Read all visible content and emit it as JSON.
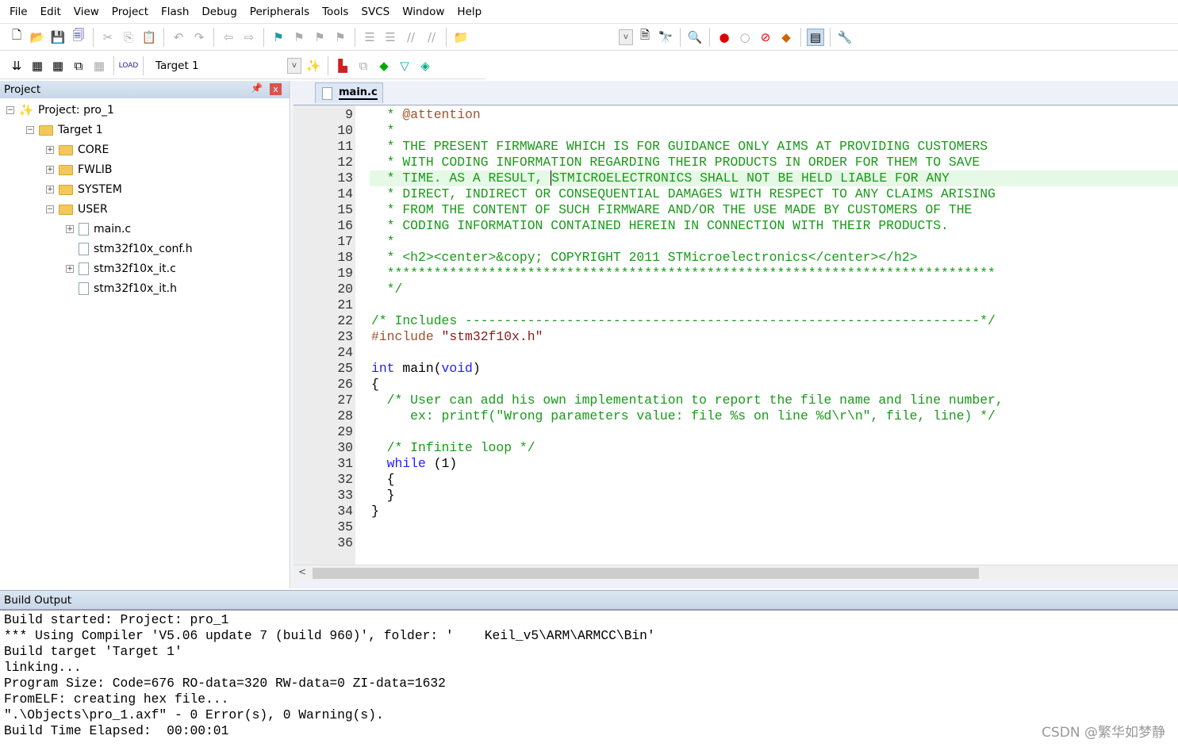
{
  "menu": [
    "File",
    "Edit",
    "View",
    "Project",
    "Flash",
    "Debug",
    "Peripherals",
    "Tools",
    "SVCS",
    "Window",
    "Help"
  ],
  "toolbar2": {
    "target": "Target 1"
  },
  "project": {
    "title": "Project",
    "pin": "📌",
    "close": "x",
    "items": [
      {
        "label": "Project: pro_1",
        "level": 0,
        "exp": "−",
        "kind": "project"
      },
      {
        "label": "Target 1",
        "level": 1,
        "exp": "−",
        "kind": "target"
      },
      {
        "label": "CORE",
        "level": 2,
        "exp": "+",
        "kind": "folder"
      },
      {
        "label": "FWLIB",
        "level": 2,
        "exp": "+",
        "kind": "folder"
      },
      {
        "label": "SYSTEM",
        "level": 2,
        "exp": "+",
        "kind": "folder"
      },
      {
        "label": "USER",
        "level": 2,
        "exp": "−",
        "kind": "folder"
      },
      {
        "label": "main.c",
        "level": 3,
        "exp": "+",
        "kind": "file"
      },
      {
        "label": "stm32f10x_conf.h",
        "level": 3,
        "exp": "",
        "kind": "file"
      },
      {
        "label": "stm32f10x_it.c",
        "level": 3,
        "exp": "+",
        "kind": "file"
      },
      {
        "label": "stm32f10x_it.h",
        "level": 3,
        "exp": "",
        "kind": "file"
      }
    ]
  },
  "editor": {
    "tab": "main.c",
    "lines": [
      {
        "n": "9",
        "t": [
          [
            "cm",
            "  * "
          ],
          [
            "doc",
            "@attention"
          ]
        ]
      },
      {
        "n": "10",
        "t": [
          [
            "cm",
            "  *"
          ]
        ]
      },
      {
        "n": "11",
        "t": [
          [
            "cm",
            "  * THE PRESENT FIRMWARE WHICH IS FOR GUIDANCE ONLY AIMS AT PROVIDING CUSTOMERS"
          ]
        ]
      },
      {
        "n": "12",
        "t": [
          [
            "cm",
            "  * WITH CODING INFORMATION REGARDING THEIR PRODUCTS IN ORDER FOR THEM TO SAVE"
          ]
        ]
      },
      {
        "n": "13",
        "hl": true,
        "t": [
          [
            "cm",
            "  * TIME. AS A RESULT, "
          ],
          [
            "caret",
            "STMICROELECTRONICS SHALL NOT BE HELD LIABLE FOR ANY"
          ]
        ]
      },
      {
        "n": "14",
        "t": [
          [
            "cm",
            "  * DIRECT, INDIRECT OR CONSEQUENTIAL DAMAGES WITH RESPECT TO ANY CLAIMS ARISING"
          ]
        ]
      },
      {
        "n": "15",
        "t": [
          [
            "cm",
            "  * FROM THE CONTENT OF SUCH FIRMWARE AND/OR THE USE MADE BY CUSTOMERS OF THE"
          ]
        ]
      },
      {
        "n": "16",
        "t": [
          [
            "cm",
            "  * CODING INFORMATION CONTAINED HEREIN IN CONNECTION WITH THEIR PRODUCTS."
          ]
        ]
      },
      {
        "n": "17",
        "t": [
          [
            "cm",
            "  *"
          ]
        ]
      },
      {
        "n": "18",
        "t": [
          [
            "cm",
            "  * <h2><center>&copy; COPYRIGHT 2011 STMicroelectronics</center></h2>"
          ]
        ]
      },
      {
        "n": "19",
        "t": [
          [
            "cm",
            "  ******************************************************************************"
          ]
        ]
      },
      {
        "n": "20",
        "t": [
          [
            "cm",
            "  */"
          ]
        ]
      },
      {
        "n": "21",
        "t": []
      },
      {
        "n": "22",
        "t": [
          [
            "cm",
            "/* Includes ------------------------------------------------------------------*/"
          ]
        ]
      },
      {
        "n": "23",
        "t": [
          [
            "pp",
            "#include "
          ],
          [
            "str",
            "\"stm32f10x.h\""
          ]
        ]
      },
      {
        "n": "24",
        "t": []
      },
      {
        "n": "25",
        "t": [
          [
            "kw",
            "int"
          ],
          [
            "pl",
            " main("
          ],
          [
            "kw",
            "void"
          ],
          [
            "pl",
            ")"
          ]
        ]
      },
      {
        "n": "26",
        "t": [
          [
            "pl",
            "{"
          ]
        ]
      },
      {
        "n": "27",
        "t": [
          [
            "cm",
            "  /* User can add his own implementation to report the file name and line number,"
          ]
        ]
      },
      {
        "n": "28",
        "t": [
          [
            "cm",
            "     ex: printf(\"Wrong parameters value: file %s on line %d\\r\\n\", file, line) */"
          ]
        ]
      },
      {
        "n": "29",
        "t": []
      },
      {
        "n": "30",
        "t": [
          [
            "cm",
            "  /* Infinite loop */"
          ]
        ]
      },
      {
        "n": "31",
        "t": [
          [
            "kw",
            "  while"
          ],
          [
            "pl",
            " (1)"
          ]
        ]
      },
      {
        "n": "32",
        "t": [
          [
            "pl",
            "  {"
          ]
        ]
      },
      {
        "n": "33",
        "t": [
          [
            "pl",
            "  }"
          ]
        ]
      },
      {
        "n": "34",
        "t": [
          [
            "pl",
            "}"
          ]
        ]
      },
      {
        "n": "35",
        "t": []
      },
      {
        "n": "36",
        "t": []
      }
    ]
  },
  "build": {
    "title": "Build Output",
    "lines": [
      "Build started: Project: pro_1",
      "*** Using Compiler 'V5.06 update 7 (build 960)', folder: '    Keil_v5\\ARM\\ARMCC\\Bin'",
      "Build target 'Target 1'",
      "linking...",
      "Program Size: Code=676 RO-data=320 RW-data=0 ZI-data=1632",
      "FromELF: creating hex file...",
      "\".\\Objects\\pro_1.axf\" - 0 Error(s), 0 Warning(s).",
      "Build Time Elapsed:  00:00:01"
    ]
  },
  "watermark": "CSDN @繁华如梦静"
}
